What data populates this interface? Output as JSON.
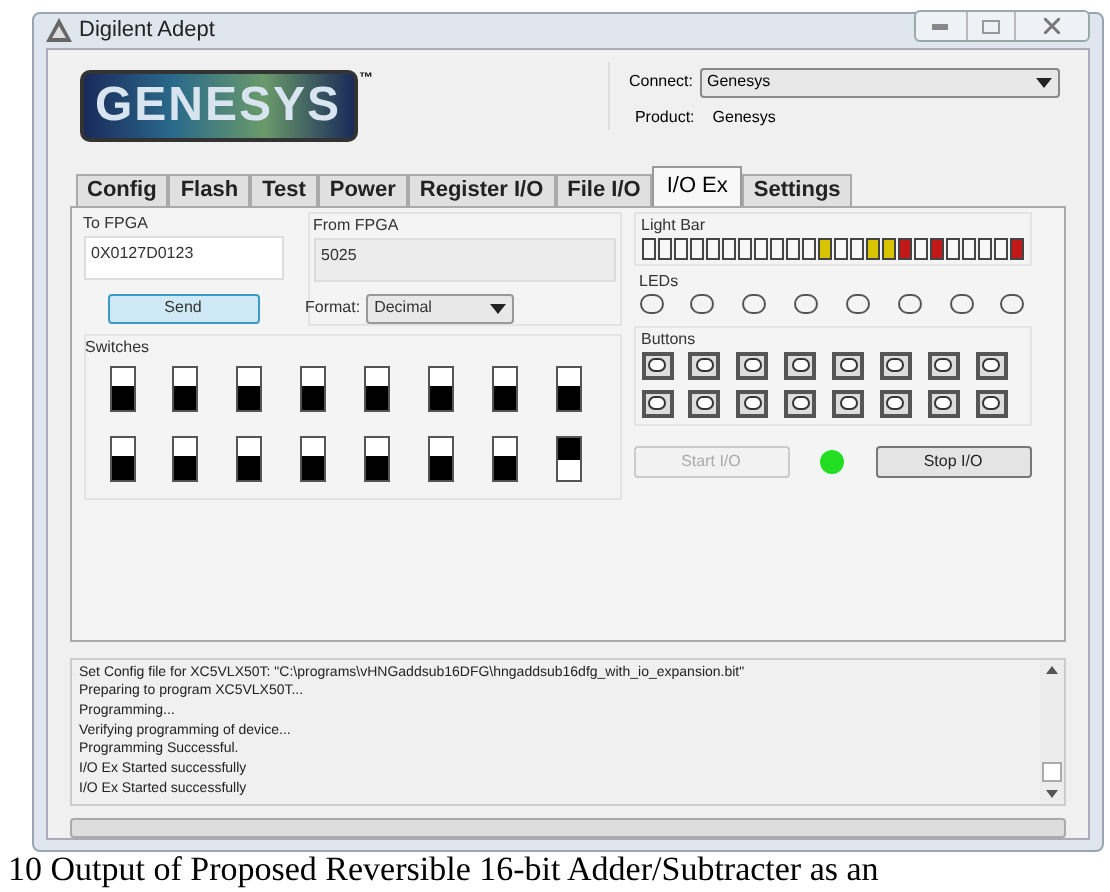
{
  "window": {
    "title": "Digilent Adept"
  },
  "logo": {
    "text": "GENESYS",
    "mark": "™"
  },
  "connect": {
    "label": "Connect:",
    "value": "Genesys"
  },
  "product": {
    "label": "Product:",
    "value": "Genesys"
  },
  "tabs": [
    {
      "label": "Config",
      "selected": false
    },
    {
      "label": "Flash",
      "selected": false
    },
    {
      "label": "Test",
      "selected": false
    },
    {
      "label": "Power",
      "selected": false
    },
    {
      "label": "Register I/O",
      "selected": false
    },
    {
      "label": "File I/O",
      "selected": false
    },
    {
      "label": "I/O Ex",
      "selected": true
    },
    {
      "label": "Settings",
      "selected": false
    }
  ],
  "to_fpga": {
    "label": "To FPGA",
    "value": "0X0127D0123",
    "button": "Send"
  },
  "from_fpga": {
    "label": "From FPGA",
    "value": "5025",
    "format_label": "Format:",
    "format_value": "Decimal"
  },
  "switches": {
    "label": "Switches",
    "items": [
      {
        "on": false
      },
      {
        "on": false
      },
      {
        "on": false
      },
      {
        "on": false
      },
      {
        "on": false
      },
      {
        "on": false
      },
      {
        "on": false
      },
      {
        "on": false
      },
      {
        "on": false
      },
      {
        "on": false
      },
      {
        "on": false
      },
      {
        "on": false
      },
      {
        "on": false
      },
      {
        "on": false
      },
      {
        "on": false
      },
      {
        "on": true
      }
    ]
  },
  "light_bar": {
    "label": "Light Bar",
    "segments": [
      {
        "on": false
      },
      {
        "on": false
      },
      {
        "on": false
      },
      {
        "on": false
      },
      {
        "on": false
      },
      {
        "on": false
      },
      {
        "on": false
      },
      {
        "on": false
      },
      {
        "on": false
      },
      {
        "on": false
      },
      {
        "on": false
      },
      {
        "on": true,
        "color": "#d8c400"
      },
      {
        "on": false
      },
      {
        "on": false
      },
      {
        "on": true,
        "color": "#d8c400"
      },
      {
        "on": true,
        "color": "#d8c400"
      },
      {
        "on": true,
        "color": "#c01818"
      },
      {
        "on": false
      },
      {
        "on": true,
        "color": "#c01818"
      },
      {
        "on": false
      },
      {
        "on": false
      },
      {
        "on": false
      },
      {
        "on": false
      },
      {
        "on": true,
        "color": "#c01818"
      }
    ]
  },
  "leds": {
    "label": "LEDs",
    "items": [
      {
        "on": false
      },
      {
        "on": false
      },
      {
        "on": false
      },
      {
        "on": false
      },
      {
        "on": false
      },
      {
        "on": false
      },
      {
        "on": false
      },
      {
        "on": false
      }
    ]
  },
  "buttons": {
    "label": "Buttons",
    "items": [
      {
        "pressed": false
      },
      {
        "pressed": false
      },
      {
        "pressed": false
      },
      {
        "pressed": false
      },
      {
        "pressed": false
      },
      {
        "pressed": false
      },
      {
        "pressed": false
      },
      {
        "pressed": false
      },
      {
        "pressed": false
      },
      {
        "pressed": false
      },
      {
        "pressed": false
      },
      {
        "pressed": false
      },
      {
        "pressed": false
      },
      {
        "pressed": false
      },
      {
        "pressed": false
      },
      {
        "pressed": false
      }
    ]
  },
  "start": {
    "label": "Start I/O",
    "disabled": true
  },
  "status": {
    "color": "#22dd22"
  },
  "stop": {
    "label": "Stop I/O",
    "disabled": false
  },
  "log": [
    "Set Config file for XC5VLX50T:  \"C:\\programs\\vHNGaddsub16DFG\\hngaddsub16dfg_with_io_expansion.bit\"",
    "Preparing to program XC5VLX50T...",
    "Programming...",
    "Verifying programming of device...",
    "Programming Successful.",
    "I/O Ex Started successfully",
    "I/O Ex Started successfully"
  ],
  "caption": "10 Output of Proposed Reversible 16-bit Adder/Subtracter as an"
}
